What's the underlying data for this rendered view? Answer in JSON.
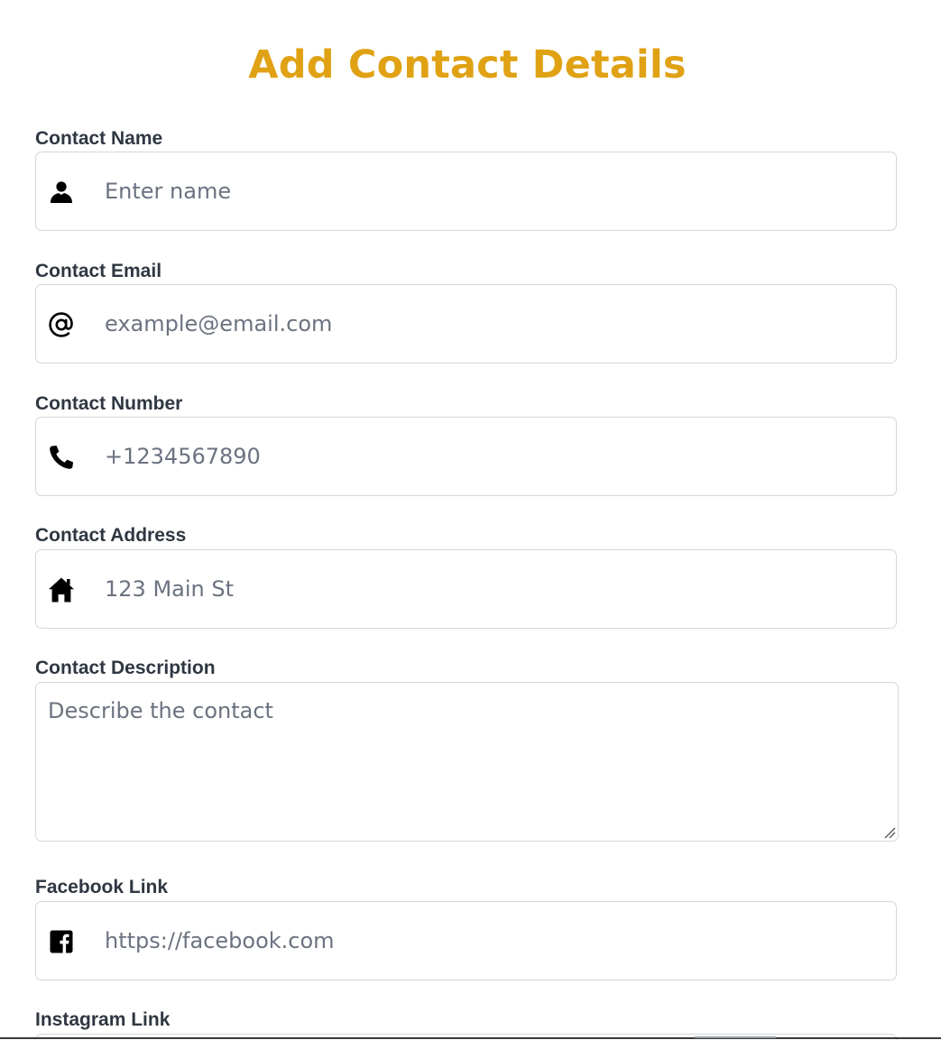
{
  "form": {
    "title": "Add Contact Details",
    "fields": {
      "name": {
        "label": "Contact Name",
        "placeholder": "Enter name",
        "icon": "user-icon"
      },
      "email": {
        "label": "Contact Email",
        "placeholder": "example@email.com",
        "icon": "at-sign-icon"
      },
      "number": {
        "label": "Contact Number",
        "placeholder": "+1234567890",
        "icon": "phone-icon"
      },
      "address": {
        "label": "Contact Address",
        "placeholder": "123 Main St",
        "icon": "home-icon"
      },
      "description": {
        "label": "Contact Description",
        "placeholder": "Describe the contact"
      },
      "facebook": {
        "label": "Facebook Link",
        "placeholder": "https://facebook.com",
        "icon": "facebook-icon"
      },
      "instagram": {
        "label": "Instagram Link"
      }
    }
  },
  "colors": {
    "title": "#e0a214",
    "label": "#2f3742",
    "placeholder": "#6b7280",
    "border": "#d3d6db"
  }
}
